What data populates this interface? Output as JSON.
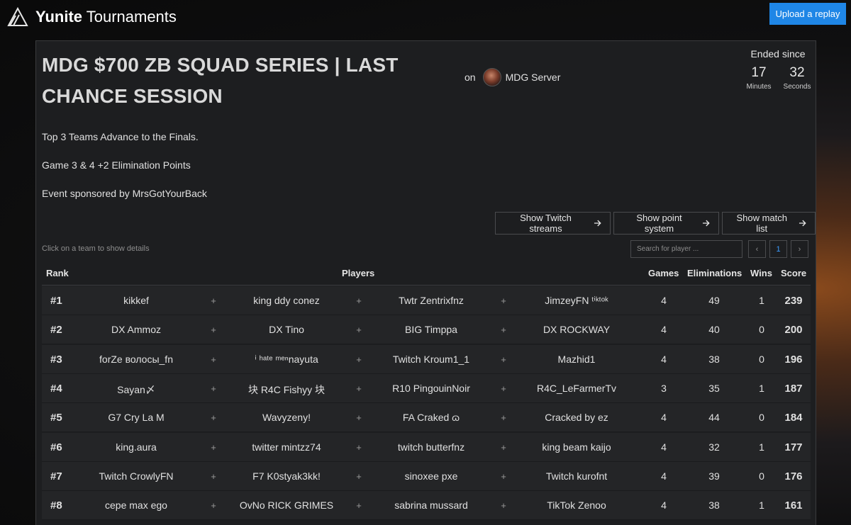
{
  "header": {
    "brand_bold": "Yunite",
    "brand_rest": " Tournaments",
    "upload_label": "Upload a replay"
  },
  "tournament": {
    "title": "MDG $700 ZB SQUAD SERIES | LAST CHANCE SESSION",
    "on_label": "on",
    "server_name": "MDG Server",
    "ended_label": "Ended since",
    "minutes_value": "17",
    "minutes_label": "Minutes",
    "seconds_value": "32",
    "seconds_label": "Seconds",
    "description": [
      "Top 3 Teams Advance to the Finals.",
      "Game 3 & 4 +2 Elimination Points",
      "Event sponsored by MrsGotYourBack"
    ]
  },
  "actions": {
    "twitch": "Show Twitch streams",
    "points": "Show point system",
    "matches": "Show match list"
  },
  "table": {
    "hint": "Click on a team to show details",
    "search_placeholder": "Search for player ...",
    "pager": {
      "prev": "‹",
      "current": "1",
      "next": "›"
    },
    "headers": {
      "rank": "Rank",
      "players": "Players",
      "games": "Games",
      "eliminations": "Eliminations",
      "wins": "Wins",
      "score": "Score"
    },
    "plus": "+",
    "rows": [
      {
        "rank": "#1",
        "players": [
          "kikkef",
          "king ddy conez",
          "Twtr Zentrixfnz",
          "JimzeyFN ᵗⁱᵏᵗᵒᵏ"
        ],
        "games": "4",
        "eliminations": "49",
        "wins": "1",
        "score": "239"
      },
      {
        "rank": "#2",
        "players": [
          "DX Ammoz",
          "DX Tino",
          "BIG Timppa",
          "DX ROCKWAY"
        ],
        "games": "4",
        "eliminations": "40",
        "wins": "0",
        "score": "200"
      },
      {
        "rank": "#3",
        "players": [
          "forZe волосы_fn",
          "ⁱ ʰᵃᵗᵉ ᵐᵉⁿnayuta",
          "Twitch Kroum1_1",
          "Mazhid1"
        ],
        "games": "4",
        "eliminations": "38",
        "wins": "0",
        "score": "196"
      },
      {
        "rank": "#4",
        "players": [
          "Sayan〆",
          "块 R4C Fishyy 块",
          "R10 PingouinNoir",
          "R4C_LeFarmerTv"
        ],
        "games": "3",
        "eliminations": "35",
        "wins": "1",
        "score": "187"
      },
      {
        "rank": "#5",
        "players": [
          "G7 Cry La M",
          "Wavyzeny!",
          "FA Craked ɷ",
          "Cracked by ez"
        ],
        "games": "4",
        "eliminations": "44",
        "wins": "0",
        "score": "184"
      },
      {
        "rank": "#6",
        "players": [
          "king.aura",
          "twitter mintzz74",
          "twitch butterfnz",
          "king beam kaijo"
        ],
        "games": "4",
        "eliminations": "32",
        "wins": "1",
        "score": "177"
      },
      {
        "rank": "#7",
        "players": [
          "Twitch CrowlyFN",
          "F7 K0styak3kk!",
          "sinoxee pxe",
          "Twitch kurofnt"
        ],
        "games": "4",
        "eliminations": "39",
        "wins": "0",
        "score": "176"
      },
      {
        "rank": "#8",
        "players": [
          "cepe max ego",
          "OvNo RICK GRIMES",
          "sabrina mussard",
          "TikTok Zenoo"
        ],
        "games": "4",
        "eliminations": "38",
        "wins": "1",
        "score": "161"
      }
    ]
  }
}
